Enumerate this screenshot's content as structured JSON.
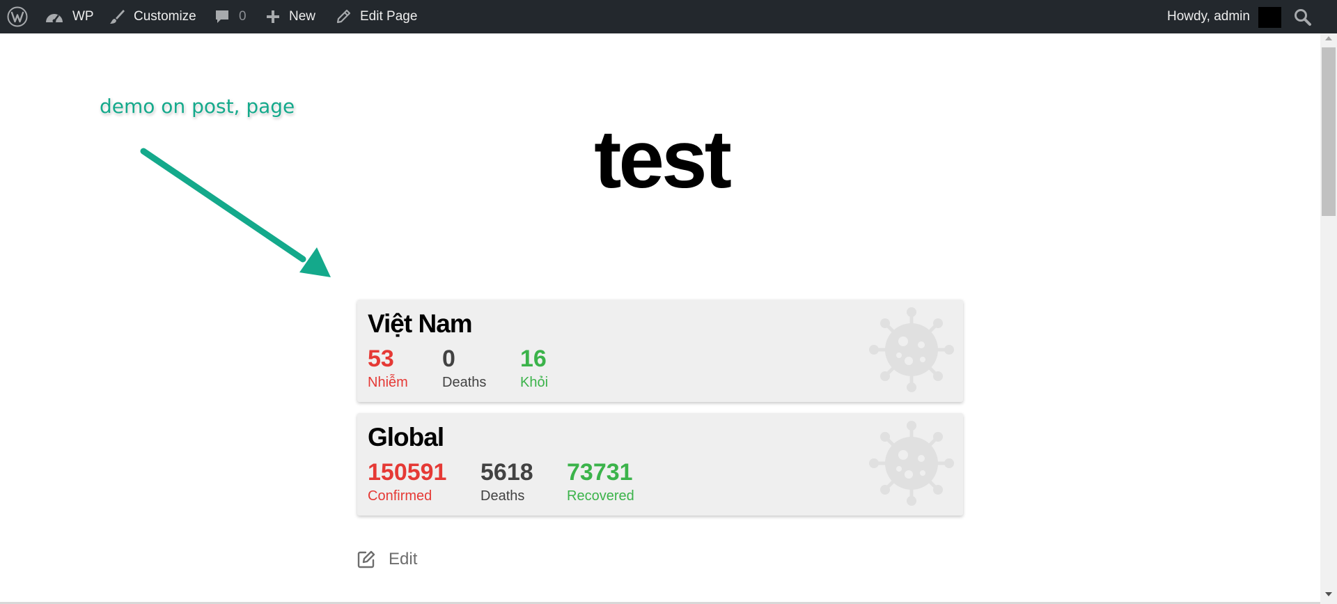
{
  "adminbar": {
    "site_name": "WP",
    "customize_label": "Customize",
    "comments_count": "0",
    "new_label": "New",
    "edit_page_label": "Edit Page",
    "howdy_label": "Howdy, admin"
  },
  "annotation": {
    "text": "demo on post, page",
    "color": "#14a98b"
  },
  "page": {
    "title": "test",
    "edit_label": "Edit"
  },
  "cards": [
    {
      "title": "Việt Nam",
      "stats": [
        {
          "value": "53",
          "label": "Nhiễm",
          "color": "#e53935"
        },
        {
          "value": "0",
          "label": "Deaths",
          "color": "#424242"
        },
        {
          "value": "16",
          "label": "Khỏi",
          "color": "#3bb34a"
        }
      ]
    },
    {
      "title": "Global",
      "stats": [
        {
          "value": "150591",
          "label": "Confirmed",
          "color": "#e53935"
        },
        {
          "value": "5618",
          "label": "Deaths",
          "color": "#424242"
        },
        {
          "value": "73731",
          "label": "Recovered",
          "color": "#3bb34a"
        }
      ]
    }
  ],
  "icons": {
    "wordpress": "wordpress-logo-icon",
    "dashboard": "dashboard-gauge-icon",
    "customize": "paintbrush-icon",
    "comments": "comment-bubble-icon",
    "new": "plus-icon",
    "edit_page": "pencil-icon",
    "search": "search-icon",
    "virus": "virus-icon",
    "edit": "edit-square-icon"
  }
}
